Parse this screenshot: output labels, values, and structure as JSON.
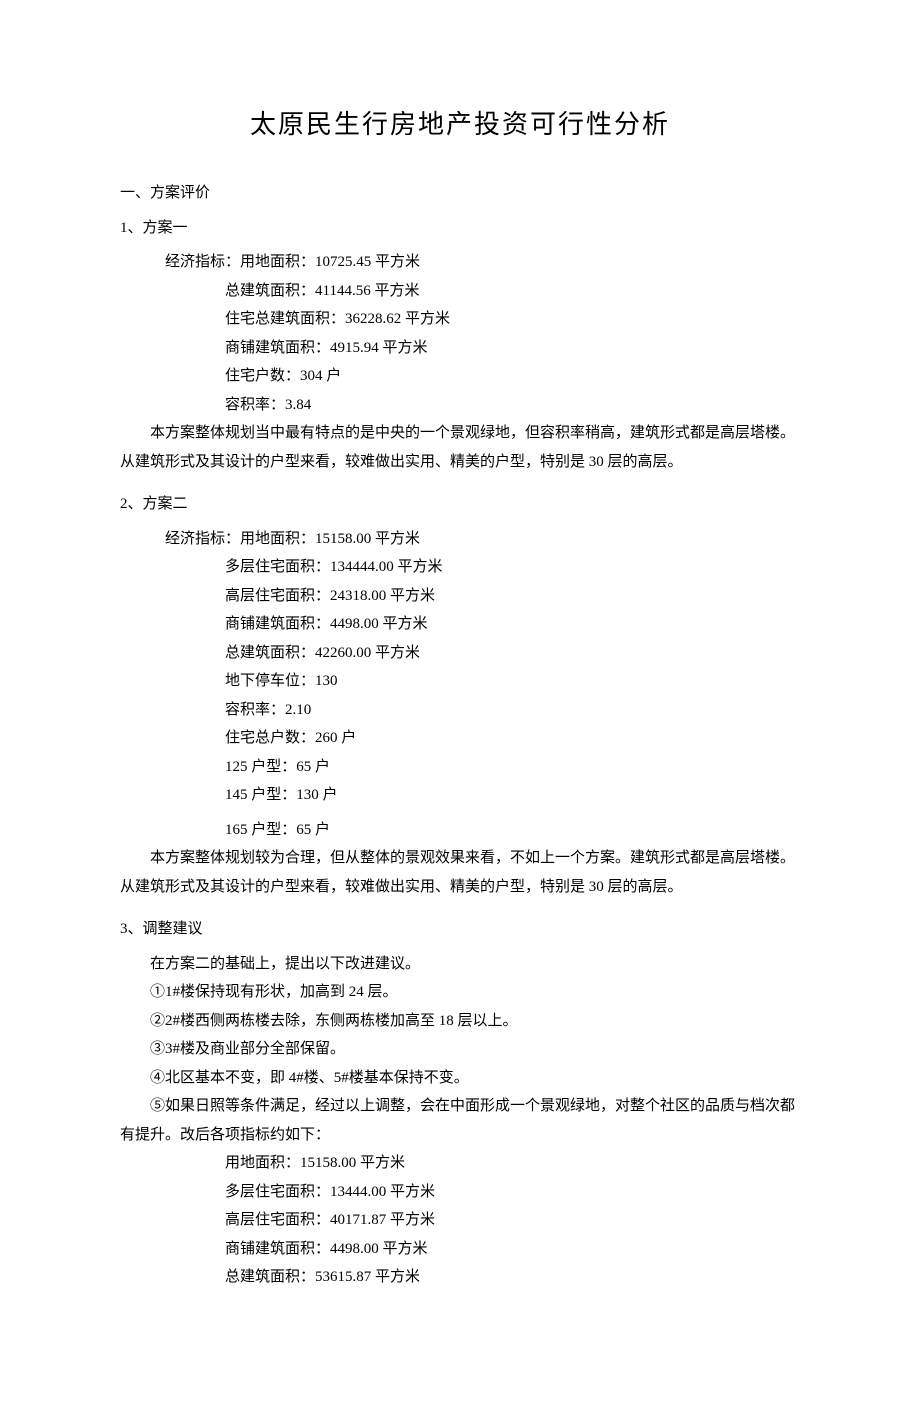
{
  "title": "太原民生行房地产投资可行性分析",
  "s1": {
    "heading": "一、方案评价",
    "p1": {
      "heading": "1、方案一",
      "metricsLabel": "经济指标：用地面积：10725.45 平方米",
      "m2": "总建筑面积：41144.56 平方米",
      "m3": "住宅总建筑面积：36228.62 平方米",
      "m4": "商铺建筑面积：4915.94 平方米",
      "m5": "住宅户数：304 户",
      "m6": "容积率：3.84",
      "body": "本方案整体规划当中最有特点的是中央的一个景观绿地，但容积率稍高，建筑形式都是高层塔楼。从建筑形式及其设计的户型来看，较难做出实用、精美的户型，特别是 30 层的高层。"
    },
    "p2": {
      "heading": "2、方案二",
      "metricsLabel": "经济指标：用地面积：15158.00 平方米",
      "m2": "多层住宅面积：134444.00 平方米",
      "m3": "高层住宅面积：24318.00 平方米",
      "m4": "商铺建筑面积：4498.00 平方米",
      "m5": "总建筑面积：42260.00 平方米",
      "m6": "地下停车位：130",
      "m7": "容积率：2.10",
      "m8": "住宅总户数：260 户",
      "m9": "125 户型：65 户",
      "m10": "145 户型：130 户",
      "m11": "165 户型：65 户",
      "body": "本方案整体规划较为合理，但从整体的景观效果来看，不如上一个方案。建筑形式都是高层塔楼。从建筑形式及其设计的户型来看，较难做出实用、精美的户型，特别是 30 层的高层。"
    },
    "p3": {
      "heading": "3、调整建议",
      "intro": "在方案二的基础上，提出以下改进建议。",
      "i1": "①1#楼保持现有形状，加高到 24 层。",
      "i2": "②2#楼西侧两栋楼去除，东侧两栋楼加高至 18 层以上。",
      "i3": "③3#楼及商业部分全部保留。",
      "i4": "④北区基本不变，即 4#楼、5#楼基本保持不变。",
      "i5": "⑤如果日照等条件满足，经过以上调整，会在中面形成一个景观绿地，对整个社区的品质与档次都有提升。改后各项指标约如下：",
      "m1": "用地面积：15158.00 平方米",
      "m2": "多层住宅面积：13444.00 平方米",
      "m3": "高层住宅面积：40171.87 平方米",
      "m4": "商铺建筑面积：4498.00 平方米",
      "m5": "总建筑面积：53615.87 平方米"
    }
  }
}
